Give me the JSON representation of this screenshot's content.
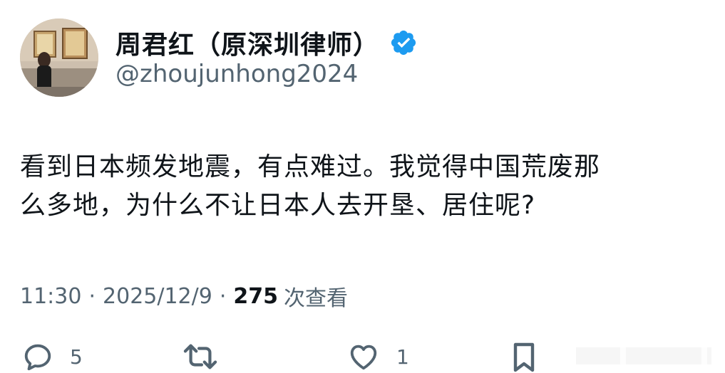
{
  "user": {
    "display_name": "周君红（原深圳律师）",
    "handle": "@zhoujunhong2024",
    "verified": true,
    "verified_color": "#1d9bf0"
  },
  "tweet": {
    "lines": [
      "看到日本频发地震，有点难过。我觉得中国荒废那",
      "么多地，为什么不让日本人去开垦、居住呢?"
    ]
  },
  "meta": {
    "time": "11:30",
    "separator": "·",
    "date": "2025/12/9",
    "views": "275",
    "views_label": "次查看"
  },
  "actions": {
    "reply_count": "5",
    "retweet_count": "",
    "like_count": "1"
  },
  "colors": {
    "text": "#0f1419",
    "secondary": "#536471"
  },
  "icons": [
    "verified-badge-icon",
    "reply-icon",
    "retweet-icon",
    "like-icon",
    "bookmark-icon"
  ]
}
